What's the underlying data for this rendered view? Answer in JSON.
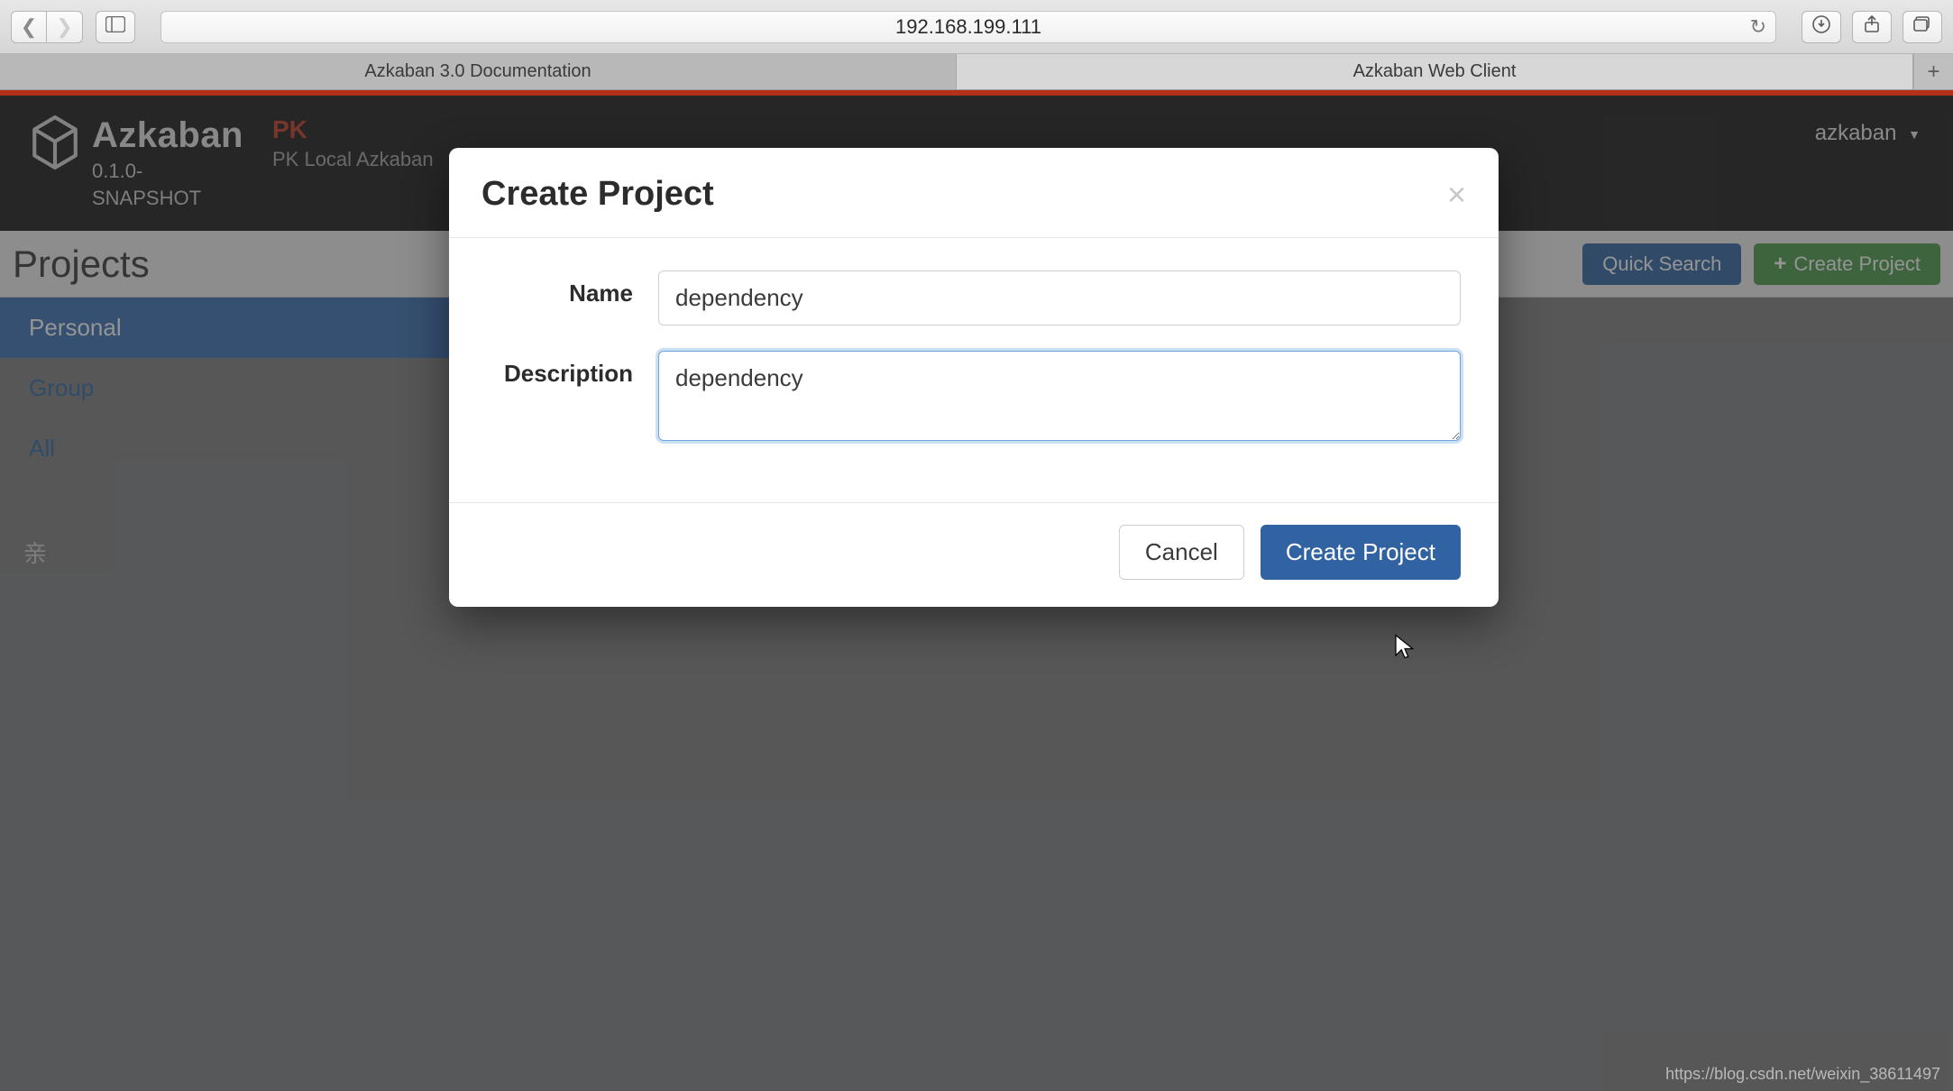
{
  "browser": {
    "url": "192.168.199.111",
    "tabs": [
      {
        "label": "Azkaban 3.0 Documentation",
        "active": false
      },
      {
        "label": "Azkaban Web Client",
        "active": true
      }
    ]
  },
  "app": {
    "name": "Azkaban",
    "version_line1": "0.1.0-",
    "version_line2": "SNAPSHOT",
    "env_label": "PK",
    "env_sub": "PK Local Azkaban",
    "user": "azkaban"
  },
  "page": {
    "title": "Projects",
    "quick_search_label": "Quick Search",
    "create_project_label": "Create Project"
  },
  "sidebar": {
    "items": [
      {
        "label": "Personal",
        "active": true
      },
      {
        "label": "Group",
        "active": false
      },
      {
        "label": "All",
        "active": false
      }
    ]
  },
  "modal": {
    "title": "Create Project",
    "name_label": "Name",
    "name_value": "dependency",
    "description_label": "Description",
    "description_value": "dependency",
    "cancel_label": "Cancel",
    "submit_label": "Create Project"
  },
  "watermark_char": "亲",
  "footer_url": "https://blog.csdn.net/weixin_38611497"
}
